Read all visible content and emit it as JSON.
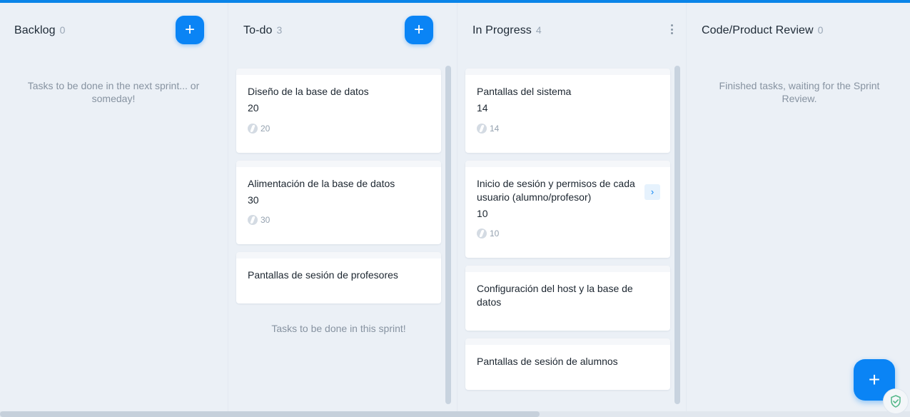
{
  "columns": [
    {
      "title": "Backlog",
      "count": "0",
      "empty_text": "Tasks to be done in the next sprint... or someday!"
    },
    {
      "title": "To-do",
      "count": "3",
      "empty_text": "Tasks to be done in this sprint!"
    },
    {
      "title": "In Progress",
      "count": "4"
    },
    {
      "title": "Code/Product Review",
      "count": "0",
      "empty_text": "Finished tasks, waiting for the Sprint Review."
    }
  ],
  "todo_cards": [
    {
      "title": "Diseño de la base de datos",
      "points": "20",
      "meta": "20"
    },
    {
      "title": "Alimentación de la base de datos",
      "points": "30",
      "meta": "30"
    },
    {
      "title": "Pantallas de sesión de profesores"
    }
  ],
  "progress_cards": [
    {
      "title": "Pantallas del sistema",
      "points": "14",
      "meta": "14"
    },
    {
      "title": "Inicio de sesión y permisos de cada usuario (alumno/profesor)",
      "points": "10",
      "meta": "10"
    },
    {
      "title": "Configuración del host y la base de datos"
    },
    {
      "title": "Pantallas de sesión de alumnos"
    }
  ],
  "buttons": {
    "add": "+",
    "fab": "+",
    "chevron": "›"
  },
  "icons": {
    "card_meta": "spark-icon",
    "more": "more-vertical-icon",
    "shield": "shield-check-icon"
  },
  "colors": {
    "accent": "#0a84f5",
    "background": "#ebf0f6"
  }
}
